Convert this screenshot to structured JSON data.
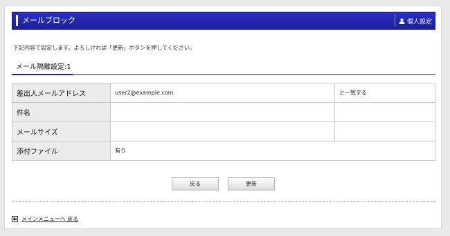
{
  "header": {
    "title": "メールブロック",
    "settings_label": "個人設定",
    "colors": {
      "bar": "#1b1f9a",
      "text": "#ffffff"
    }
  },
  "intro_text": "下記内容で設定します。よろしければ「更新」ボタンを押してください。",
  "section": {
    "title": "メール隔離設定:1"
  },
  "form_rows": [
    {
      "label": "差出人メールアドレス",
      "value": "user2@example.com",
      "condition": "と一致する"
    },
    {
      "label": "件名",
      "value": "",
      "condition": ""
    },
    {
      "label": "メールサイズ",
      "value": "",
      "condition": ""
    },
    {
      "label": "添付ファイル",
      "value": "有り"
    }
  ],
  "buttons": {
    "back": "戻る",
    "update": "更新"
  },
  "footer": {
    "menu_link": "メインメニューへ 戻る",
    "icon": "back-arrow-icon"
  }
}
